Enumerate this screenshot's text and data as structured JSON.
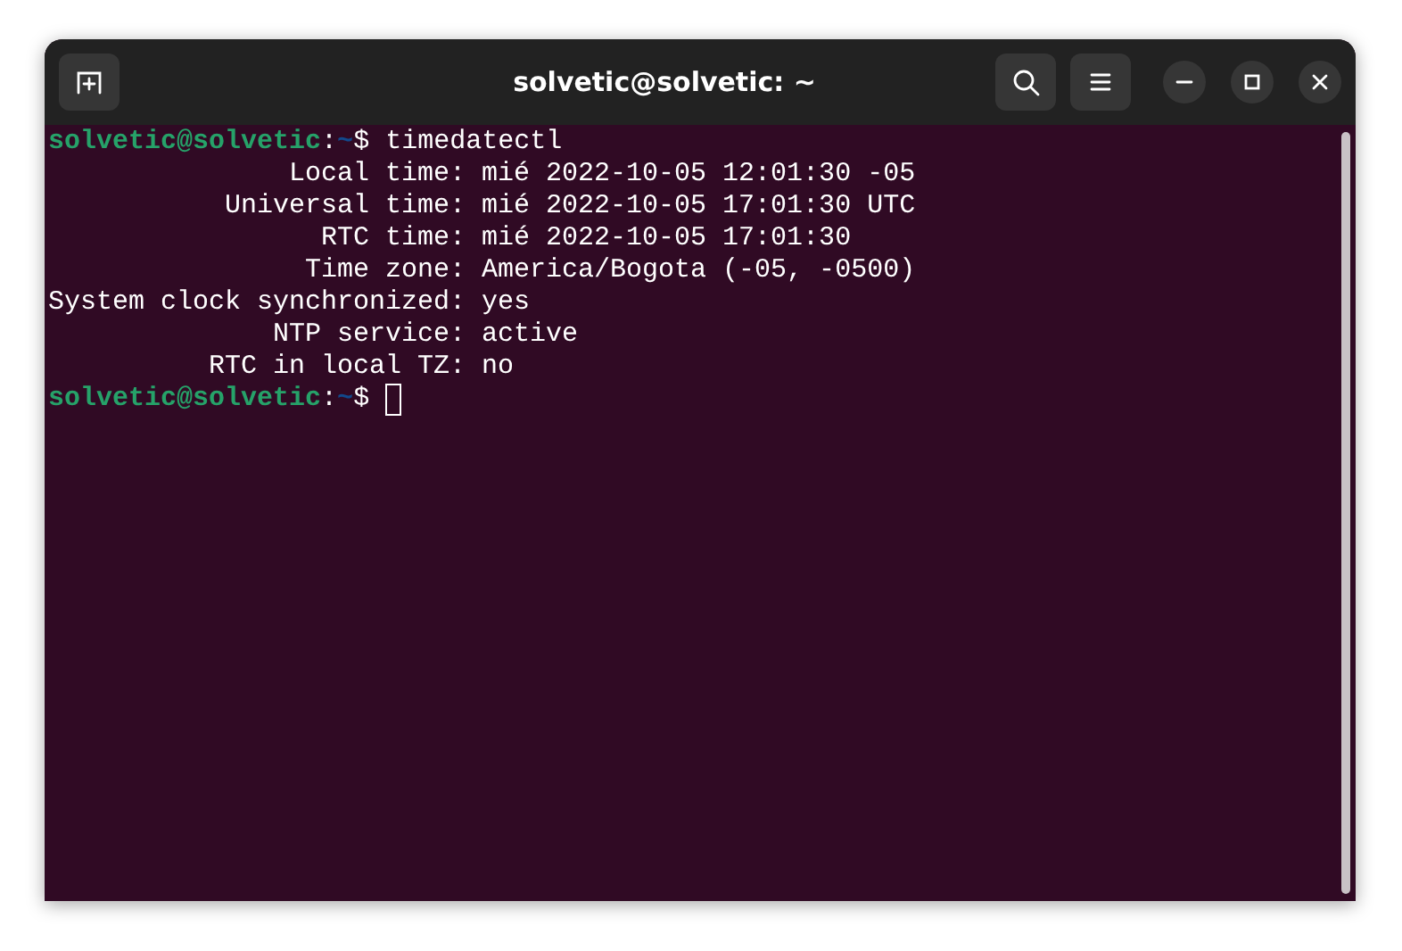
{
  "window": {
    "title": "solvetic@solvetic: ~"
  },
  "terminal": {
    "lines": [
      {
        "kind": "prompt",
        "user_host": "solvetic@solvetic",
        "separator": ":",
        "path": "~",
        "symbol": "$",
        "command": "timedatectl",
        "cursor": false
      },
      {
        "kind": "field",
        "label": "Local time:",
        "value": "mié 2022-10-05 12:01:30 -05"
      },
      {
        "kind": "field",
        "label": "Universal time:",
        "value": "mié 2022-10-05 17:01:30 UTC"
      },
      {
        "kind": "field",
        "label": "RTC time:",
        "value": "mié 2022-10-05 17:01:30"
      },
      {
        "kind": "field",
        "label": "Time zone:",
        "value": "America/Bogota (-05, -0500)"
      },
      {
        "kind": "field",
        "label": "System clock synchronized:",
        "value": "yes"
      },
      {
        "kind": "field",
        "label": "NTP service:",
        "value": "active"
      },
      {
        "kind": "field",
        "label": "RTC in local TZ:",
        "value": "no"
      },
      {
        "kind": "prompt",
        "user_host": "solvetic@solvetic",
        "separator": ":",
        "path": "~",
        "symbol": "$",
        "cursor": true
      }
    ]
  }
}
